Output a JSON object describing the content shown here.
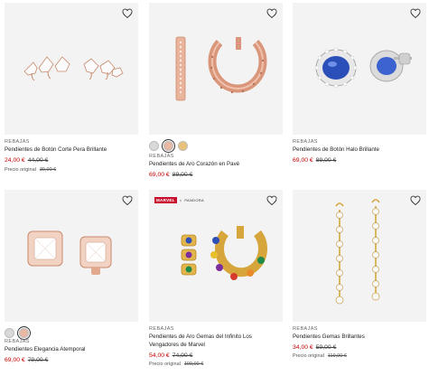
{
  "products": [
    {
      "tag": "REBAJAS",
      "name": "Pendientes de Botón Corte Pera Brillante",
      "price": "24,00 €",
      "old_price": "44,00 €",
      "orig_label": "Precio original",
      "orig_value": "39,00 €",
      "image": "teardrop-stud-earrings"
    },
    {
      "tag": "REBAJAS",
      "name": "Pendientes de Aro Corazón en Pavé",
      "price": "69,00 €",
      "old_price": "89,00 €",
      "swatches": [
        "#d9d9d9",
        "#e9b8a5",
        "#e8c27a"
      ],
      "selected_swatch": 1,
      "image": "rose-gold-heart-hoops"
    },
    {
      "tag": "REBAJAS",
      "name": "Pendientes de Botón Halo Brillante",
      "price": "69,00 €",
      "old_price": "89,00 €",
      "image": "blue-halo-stud"
    },
    {
      "tag": "REBAJAS",
      "name": "Pendientes Elegancia Atemporal",
      "price": "69,00 €",
      "old_price": "79,00 €",
      "swatches": [
        "#d9d9d9",
        "#e9b8a5"
      ],
      "selected_swatch": 1,
      "image": "square-halo-stud"
    },
    {
      "tag": "REBAJAS",
      "name": "Pendientes de Aro Gemas del Infinito Los Vengadores de Marvel",
      "price": "54,00 €",
      "old_price": "74,00 €",
      "orig_label": "Precio original",
      "orig_value": "109,00 €",
      "brand_marvel": "MARVEL",
      "brand_x": "×",
      "brand_pandora": "PANDORA",
      "image": "infinity-gem-hoops"
    },
    {
      "tag": "REBAJAS",
      "name": "Pendientes Gemas Brillantes",
      "price": "34,00 €",
      "old_price": "59,00 €",
      "orig_label": "Precio original",
      "orig_value": "119,00 €",
      "image": "drop-gem-earrings"
    }
  ],
  "colors": {
    "sale_price": "#c40000",
    "image_bg": "#f3f3f3",
    "rose_gold": "#d9967a",
    "gold": "#d6a63c"
  },
  "icons": {
    "wishlist": "heart-outline-icon"
  }
}
